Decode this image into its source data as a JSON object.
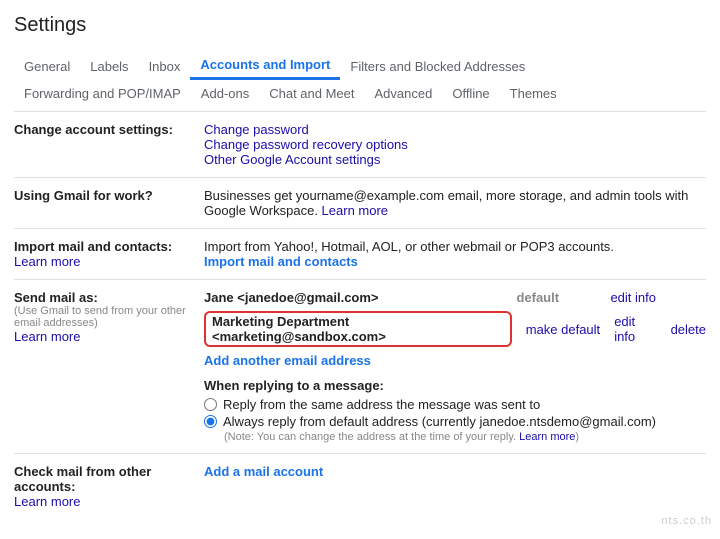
{
  "title": "Settings",
  "tabs": {
    "general": "General",
    "labels": "Labels",
    "inbox": "Inbox",
    "accounts": "Accounts and Import",
    "filters": "Filters and Blocked Addresses",
    "forwarding": "Forwarding and POP/IMAP",
    "addons": "Add-ons",
    "chat": "Chat and Meet",
    "advanced": "Advanced",
    "offline": "Offline",
    "themes": "Themes"
  },
  "sections": {
    "change": {
      "heading": "Change account settings:",
      "links": {
        "password": "Change password",
        "recovery": "Change password recovery options",
        "other": "Other Google Account settings"
      }
    },
    "work": {
      "heading": "Using Gmail for work?",
      "body_a": "Businesses get yourname@example.com email, more storage, and admin tools with Google Workspace. ",
      "learn": "Learn more"
    },
    "import": {
      "heading": "Import mail and contacts:",
      "body": "Import from Yahoo!, Hotmail, AOL, or other webmail or POP3 accounts.",
      "learn": "Learn more",
      "action": "Import mail and contacts"
    },
    "send_as": {
      "heading": "Send mail as:",
      "sub": "(Use Gmail to send from your other email addresses)",
      "learn": "Learn more",
      "rows": [
        {
          "main": "Jane <janedoe@gmail.com>",
          "default_label": "default",
          "edit": "edit info"
        },
        {
          "main": "Marketing Department <marketing@sandbox.com>",
          "make_default": "make default",
          "edit": "edit info",
          "delete": "delete"
        }
      ],
      "add_another": "Add another email address",
      "reply_heading": "When replying to a message:",
      "reply_same": "Reply from the same address the message was sent to",
      "reply_default": "Always reply from default address (currently janedoe.ntsdemo@gmail.com)",
      "reply_note_a": "(Note: You can change the address at the time of your reply. ",
      "reply_note_learn": "Learn more",
      "reply_note_b": ")"
    },
    "check": {
      "heading": "Check mail from other accounts:",
      "learn": "Learn more",
      "action": "Add a mail account"
    }
  },
  "watermark": "nts.co.th"
}
